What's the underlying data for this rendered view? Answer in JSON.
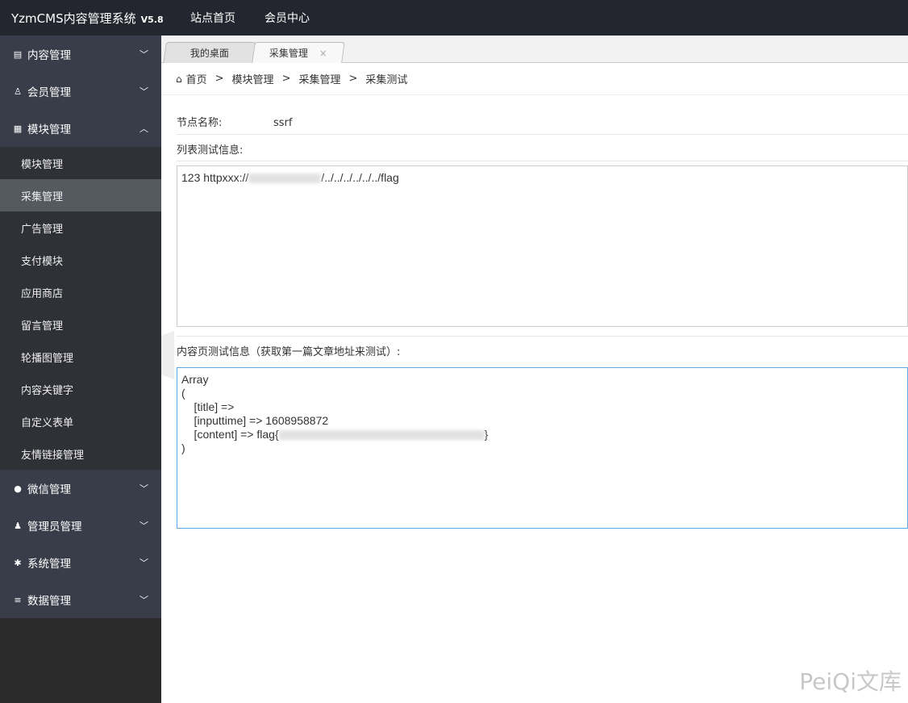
{
  "header": {
    "logo": "YzmCMS内容管理系统",
    "version": "V5.8",
    "nav": [
      "站点首页",
      "会员中心"
    ]
  },
  "sidebar": {
    "groups_top": [
      {
        "label": "内容管理",
        "icon": "book-icon"
      },
      {
        "label": "会员管理",
        "icon": "user-outline-icon"
      },
      {
        "label": "模块管理",
        "icon": "grid-icon",
        "expanded": true
      }
    ],
    "sub": [
      "模块管理",
      "采集管理",
      "广告管理",
      "支付模块",
      "应用商店",
      "留言管理",
      "轮播图管理",
      "内容关键字",
      "自定义表单",
      "友情链接管理"
    ],
    "active": "采集管理",
    "groups_bottom": [
      {
        "label": "微信管理",
        "icon": "wechat-icon"
      },
      {
        "label": "管理员管理",
        "icon": "user-icon"
      },
      {
        "label": "系统管理",
        "icon": "gear-icon"
      },
      {
        "label": "数据管理",
        "icon": "database-icon"
      }
    ]
  },
  "tabs": [
    {
      "label": "我的桌面"
    },
    {
      "label": "采集管理",
      "close": "×"
    }
  ],
  "breadcrumb": [
    "首页",
    "模块管理",
    "采集管理",
    "采集测试"
  ],
  "breadcrumb_sep": ">",
  "form": {
    "node_label": "节点名称:",
    "node_value": "ssrf",
    "list_label": "列表测试信息:",
    "list_prefix": "123 httpxxx://",
    "list_suffix": "/../../../../../../flag",
    "content_label": "内容页测试信息（获取第一篇文章地址来测试）:",
    "content_lines": [
      "Array",
      "(",
      "    [title] => ",
      "    [inputtime] => 1608958872"
    ],
    "content_flag_prefix": "    [content] => flag{",
    "content_flag_suffix": "}",
    "content_end": ")"
  },
  "watermark": "PeiQi文库"
}
